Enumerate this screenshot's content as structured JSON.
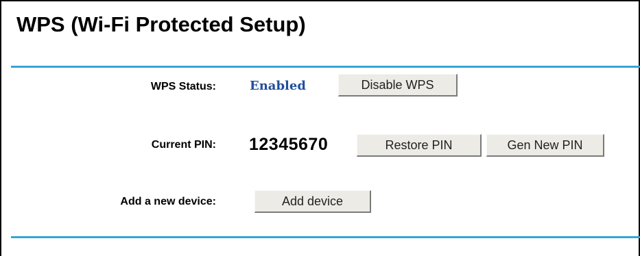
{
  "page": {
    "title": "WPS (Wi-Fi Protected Setup)"
  },
  "wps_status": {
    "label": "WPS Status:",
    "value": "Enabled",
    "toggle_button": "Disable WPS"
  },
  "current_pin": {
    "label": "Current PIN:",
    "value": "12345670",
    "restore_button": "Restore PIN",
    "generate_button": "Gen New PIN"
  },
  "add_device": {
    "label": "Add a new device:",
    "button": "Add device"
  },
  "colors": {
    "divider": "#33a5d8",
    "status_value": "#1f4e9c",
    "button_face": "#ecebe6"
  }
}
